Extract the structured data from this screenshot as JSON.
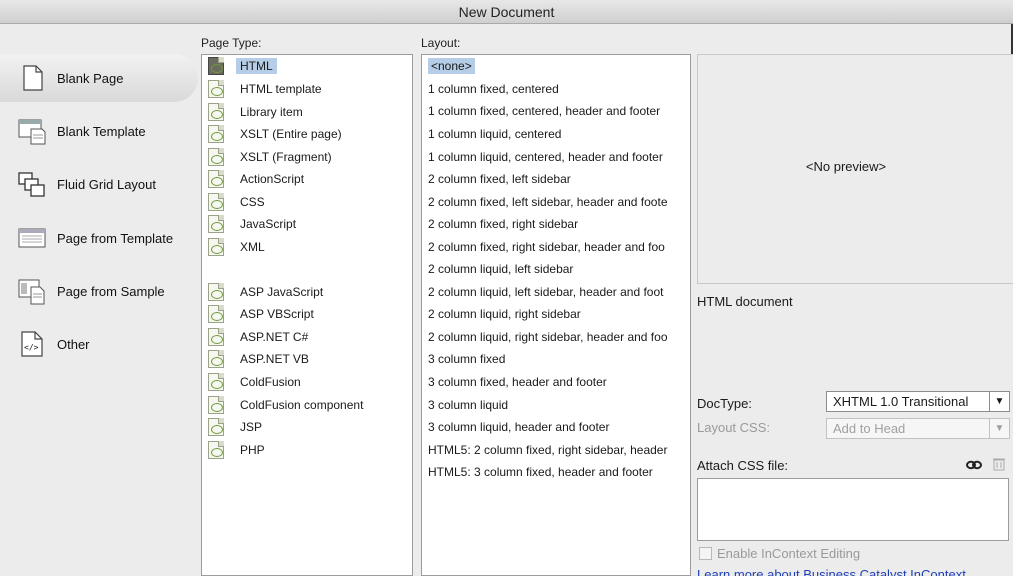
{
  "window": {
    "title": "New Document"
  },
  "sidebar": {
    "items": [
      {
        "label": "Blank Page",
        "icon": "blank-page-icon",
        "selected": true
      },
      {
        "label": "Blank Template",
        "icon": "blank-template-icon"
      },
      {
        "label": "Fluid Grid Layout",
        "icon": "fluid-grid-icon"
      },
      {
        "label": "Page from Template",
        "icon": "page-from-template-icon"
      },
      {
        "label": "Page from Sample",
        "icon": "page-from-sample-icon"
      },
      {
        "label": "Other",
        "icon": "code-tag-icon"
      }
    ]
  },
  "page_type": {
    "header": "Page Type:",
    "selected": "HTML",
    "items": [
      "HTML",
      "HTML template",
      "Library item",
      "XSLT (Entire page)",
      "XSLT (Fragment)",
      "ActionScript",
      "CSS",
      "JavaScript",
      "XML",
      "ASP JavaScript",
      "ASP VBScript",
      "ASP.NET C#",
      "ASP.NET VB",
      "ColdFusion",
      "ColdFusion component",
      "JSP",
      "PHP"
    ]
  },
  "layout": {
    "header": "Layout:",
    "selected": "<none>",
    "items": [
      "<none>",
      "1 column fixed, centered",
      "1 column fixed, centered, header and footer",
      "1 column liquid, centered",
      "1 column liquid, centered, header and footer",
      "2 column fixed, left sidebar",
      "2 column fixed, left sidebar, header and foote",
      "2 column fixed, right sidebar",
      "2 column fixed, right sidebar, header and foo",
      "2 column liquid, left sidebar",
      "2 column liquid, left sidebar, header and foot",
      "2 column liquid, right sidebar",
      "2 column liquid, right sidebar, header and foo",
      "3 column fixed",
      "3 column fixed, header and footer",
      "3 column liquid",
      "3 column liquid, header and footer",
      "HTML5: 2 column fixed, right sidebar, header",
      "HTML5: 3 column fixed, header and footer"
    ]
  },
  "preview": {
    "text": "<No preview>",
    "description": "HTML document"
  },
  "doctype": {
    "label": "DocType:",
    "value": "XHTML 1.0 Transitional"
  },
  "layout_css": {
    "label": "Layout CSS:",
    "value": "Add to Head"
  },
  "attach_css": {
    "label": "Attach CSS file:"
  },
  "incontext": {
    "label": "Enable InContext Editing",
    "checked": false
  },
  "learn_more": {
    "text": "Learn more about Business Catalyst InContext"
  },
  "colors": {
    "selection": "#b5cde6",
    "link": "#1f3fb8",
    "window_bg": "#ececec"
  }
}
